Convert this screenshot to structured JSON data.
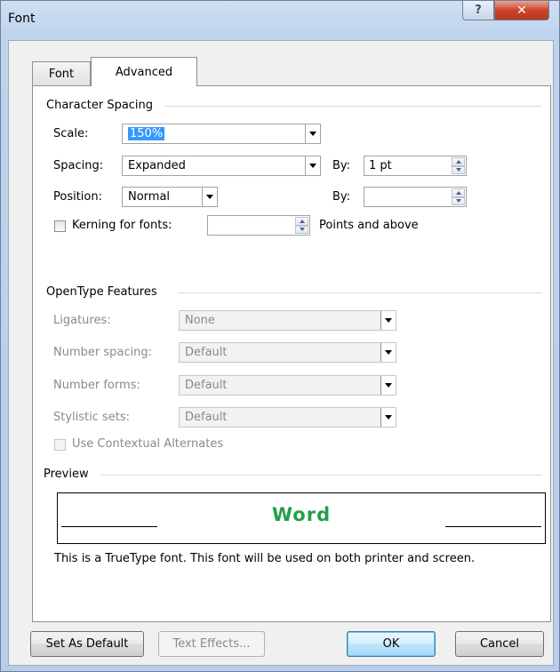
{
  "window": {
    "title": "Font",
    "help_glyph": "?",
    "close_glyph": "✕"
  },
  "tabs": [
    {
      "label": "Font",
      "active": false
    },
    {
      "label": "Advanced",
      "active": true
    }
  ],
  "character_spacing": {
    "heading": "Character Spacing",
    "scale_label": "Scale:",
    "scale_value": "150%",
    "spacing_label": "Spacing:",
    "spacing_value": "Expanded",
    "spacing_by_label": "By:",
    "spacing_by_value": "1 pt",
    "position_label": "Position:",
    "position_value": "Normal",
    "position_by_label": "By:",
    "position_by_value": "",
    "kerning_label": "Kerning for fonts:",
    "kerning_checked": false,
    "kerning_value": "",
    "kerning_suffix": "Points and above"
  },
  "opentype": {
    "heading": "OpenType Features",
    "ligatures_label": "Ligatures:",
    "ligatures_value": "None",
    "number_spacing_label": "Number spacing:",
    "number_spacing_value": "Default",
    "number_forms_label": "Number forms:",
    "number_forms_value": "Default",
    "stylistic_sets_label": "Stylistic sets:",
    "stylistic_sets_value": "Default",
    "contextual_label": "Use Contextual Alternates",
    "contextual_checked": false
  },
  "preview": {
    "heading": "Preview",
    "sample_text": "Word",
    "sample_color": "#22a04a",
    "note": "This is a TrueType font. This font will be used on both printer and screen."
  },
  "buttons": {
    "set_default": "Set As Default",
    "text_effects": "Text Effects...",
    "ok": "OK",
    "cancel": "Cancel"
  }
}
